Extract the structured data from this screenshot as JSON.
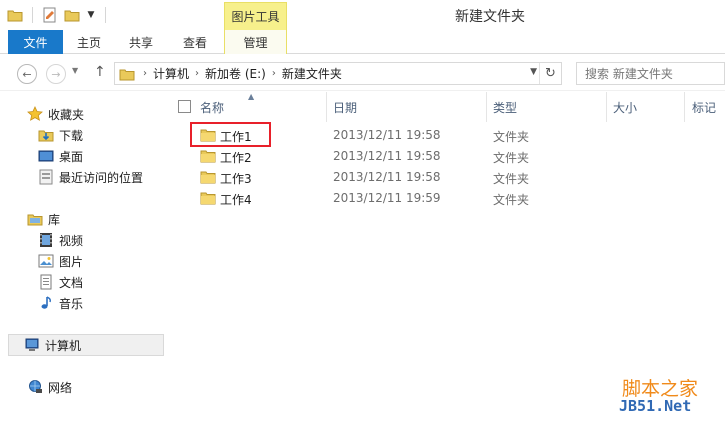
{
  "window": {
    "title": "新建文件夹",
    "contextual_tab_group": "图片工具"
  },
  "ribbon": {
    "tabs": [
      {
        "label": "文件"
      },
      {
        "label": "主页"
      },
      {
        "label": "共享"
      },
      {
        "label": "查看"
      },
      {
        "label": "管理"
      }
    ]
  },
  "address": {
    "breadcrumbs": [
      "计算机",
      "新加卷 (E:)",
      "新建文件夹"
    ]
  },
  "search": {
    "placeholder": "搜索 新建文件夹"
  },
  "navpane": {
    "favorites": {
      "label": "收藏夹",
      "items": [
        "下载",
        "桌面",
        "最近访问的位置"
      ]
    },
    "libraries": {
      "label": "库",
      "items": [
        "视频",
        "图片",
        "文档",
        "音乐"
      ]
    },
    "computer": "计算机",
    "network": "网络"
  },
  "columns": {
    "name": "名称",
    "date": "日期",
    "type": "类型",
    "size": "大小",
    "tags": "标记"
  },
  "files": [
    {
      "name": "工作1",
      "date": "2013/12/11 19:58",
      "type": "文件夹"
    },
    {
      "name": "工作2",
      "date": "2013/12/11 19:58",
      "type": "文件夹"
    },
    {
      "name": "工作3",
      "date": "2013/12/11 19:58",
      "type": "文件夹"
    },
    {
      "name": "工作4",
      "date": "2013/12/11 19:59",
      "type": "文件夹"
    }
  ],
  "watermark": {
    "line1": "脚本之家",
    "line2": "JB51.Net"
  },
  "colors": {
    "file_tab": "#1979ca",
    "contextual_tab": "#f7f08c",
    "highlight_box": "#e8202a",
    "watermark_orange": "#f08a1a",
    "watermark_blue": "#3069b4"
  }
}
